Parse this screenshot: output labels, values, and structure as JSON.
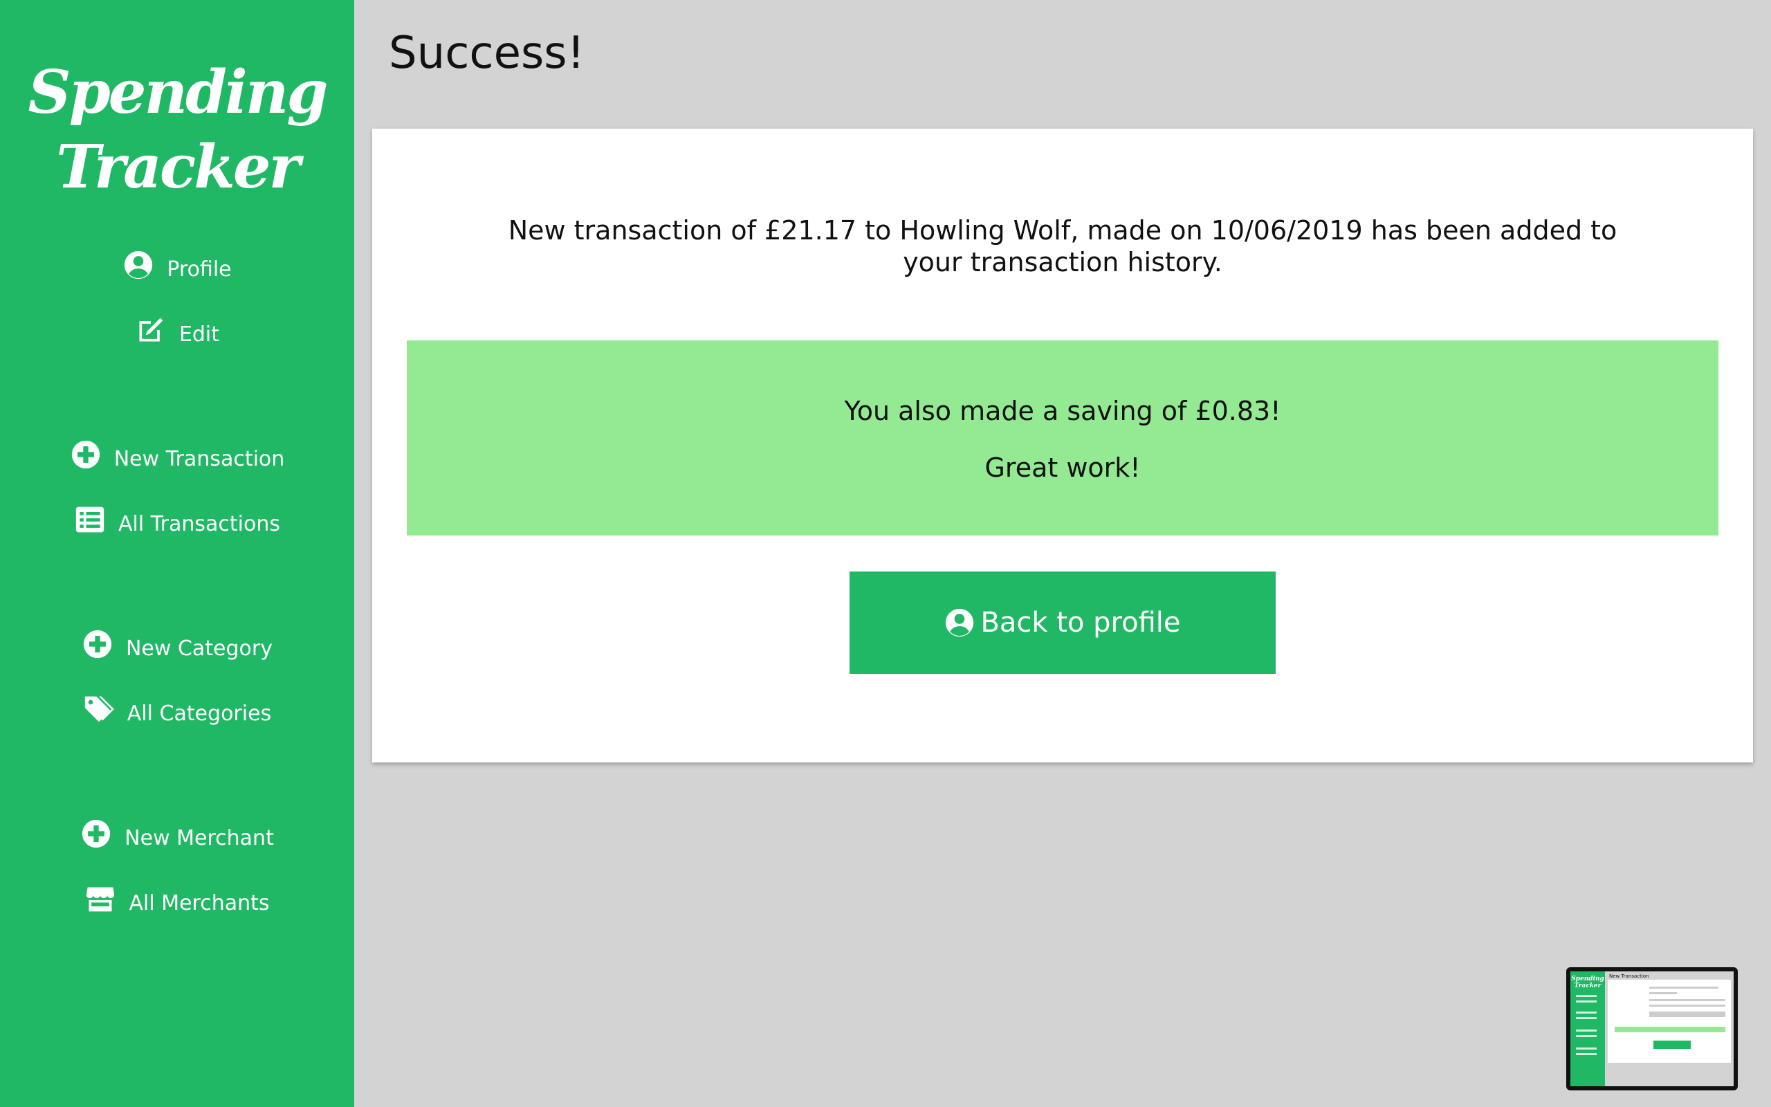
{
  "app": {
    "logo_line1": "Spending",
    "logo_line2": "Tracker"
  },
  "sidebar": {
    "items": [
      {
        "label": "Profile",
        "icon": "user-circle-icon"
      },
      {
        "label": "Edit",
        "icon": "edit-icon"
      },
      {
        "label": "New Transaction",
        "icon": "plus-circle-icon"
      },
      {
        "label": "All Transactions",
        "icon": "list-icon"
      },
      {
        "label": "New Category",
        "icon": "plus-circle-icon"
      },
      {
        "label": "All Categories",
        "icon": "tags-icon"
      },
      {
        "label": "New Merchant",
        "icon": "plus-circle-icon"
      },
      {
        "label": "All Merchants",
        "icon": "store-icon"
      }
    ]
  },
  "main": {
    "title": "Success!",
    "message": "New transaction of £21.17 to Howling Wolf, made on 10/06/2019 has been added to your transaction history.",
    "saving_line": "You also made a saving of £0.83!",
    "praise_line": "Great work!",
    "back_button_label": "Back to profile"
  },
  "thumbnail": {
    "logo_line1": "Spending",
    "logo_line2": "Tracker",
    "title": "New Transaction"
  },
  "colors": {
    "sidebar_green": "#20b865",
    "saving_green": "#93ea92",
    "background": "#d3d3d3"
  }
}
